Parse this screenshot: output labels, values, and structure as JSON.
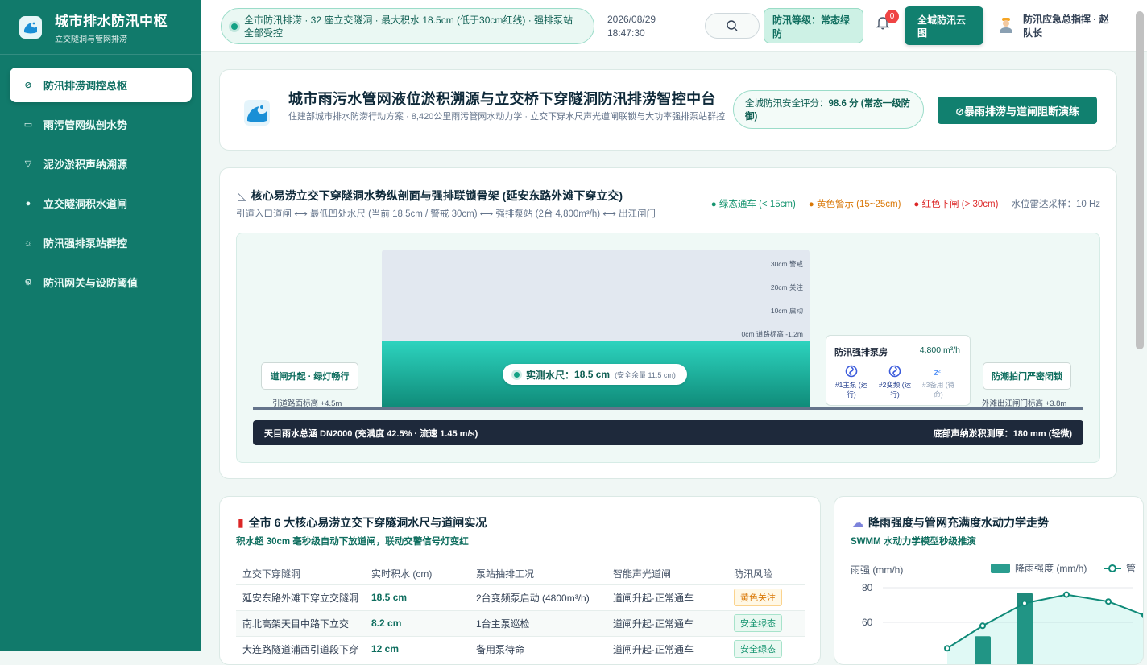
{
  "app": {
    "title": "城市排水防汛中枢",
    "subtitle": "立交隧洞与管网排涝"
  },
  "sidebar": {
    "items": [
      {
        "label": "防汛排涝调控总枢",
        "icon": "compass-icon",
        "active": true
      },
      {
        "label": "雨污管网纵剖水势",
        "icon": "monitor-icon",
        "active": false
      },
      {
        "label": "泥沙淤积声纳溯源",
        "icon": "filter-icon",
        "active": false
      },
      {
        "label": "立交隧洞积水道闸",
        "icon": "alert-icon",
        "active": false
      },
      {
        "label": "防汛强排泵站群控",
        "icon": "sun-icon",
        "active": false
      },
      {
        "label": "防汛网关与设防阈值",
        "icon": "gear-icon",
        "active": false
      }
    ]
  },
  "topbar": {
    "ticker": "全市防汛排涝 · 32 座立交隧洞 · 最大积水 18.5cm (低于30cm红线) · 强排泵站全部受控",
    "date": "2026/08/29",
    "time": "18:47:30",
    "level": "防汛等级：常态绿防",
    "notifications": "0",
    "cloud_button": "全城防汛云图",
    "user": "防汛应急总指挥 · 赵队长"
  },
  "hero": {
    "title": "城市雨污水管网液位淤积溯源与立交桥下穿隧洞防汛排涝智控中台",
    "subtitle": "住建部城市排水防涝行动方案 · 8,420公里雨污管网水动力学 · 立交下穿水尺声光道闸联锁与大功率强排泵站群控",
    "score_label": "全城防汛安全评分：",
    "score_value": "98.6 分 (常态一级防御)",
    "drill_button": "⊘暴雨排涝与道闸阻断演练"
  },
  "profile": {
    "title": "核心易涝立交下穿隧洞水势纵剖面与强排联锁骨架 (延安东路外滩下穿立交)",
    "subtitle": "引道入口道闸 ⟷ 最低凹处水尺 (当前 18.5cm / 警戒 30cm) ⟷ 强排泵站 (2台 4,800m³/h) ⟷ 出江闸门",
    "legend": [
      {
        "label": "● 绿态通车 (< 15cm)",
        "color": "#15946f"
      },
      {
        "label": "● 黄色警示 (15~25cm)",
        "color": "#d97706"
      },
      {
        "label": "● 红色下闸 (> 30cm)",
        "color": "#dc2626"
      },
      {
        "label": "水位雷达采样：10 Hz",
        "color": "#64748b"
      }
    ],
    "scale": [
      "30cm 警戒",
      "20cm 关注",
      "10cm 启动",
      "0cm 道路标高 -1.2m"
    ],
    "gauge_label": "实测水尺：",
    "gauge_value": "18.5 cm",
    "gauge_note": "(安全余量 11.5 cm)",
    "water_level_cm": 18.5,
    "left_gate": "道闸升起 · 绿灯畅行",
    "left_elev": "引道路面标高 +4.5m",
    "right_gate": "防潮拍门严密闭锁",
    "right_elev": "外滩出江闸门标高 +3.8m",
    "pumphouse_title": "防汛强排泵房",
    "pumphouse_flow": "4,800 m³/h",
    "pumps": [
      {
        "label": "#1主泵 (运行)",
        "icon": "fan-icon"
      },
      {
        "label": "#2变频 (运行)",
        "icon": "fan-icon"
      },
      {
        "label": "#3备用 (待命)",
        "icon": "sleep-icon"
      }
    ],
    "pipe_left": "天目雨水总涵 DN2000 (充满度 42.5% · 流速 1.45 m/s)",
    "pipe_right": "底部声纳淤积测厚：180 mm (轻微)"
  },
  "tunnels": {
    "title": "全市 6 大核心易涝立交下穿隧洞水尺与道闸实况",
    "subtitle": "积水超 30cm 毫秒级自动下放道闸，联动交警信号灯变红",
    "headers": [
      "立交下穿隧洞",
      "实时积水 (cm)",
      "泵站抽排工况",
      "智能声光道闸",
      "防汛风险"
    ],
    "rows": [
      {
        "name": "延安东路外滩下穿立交隧洞",
        "depth": "18.5 cm",
        "pump": "2台变频泵启动 (4800m³/h)",
        "gate": "道闸升起·正常通车",
        "risk": "黄色关注",
        "risk_level": "yellow"
      },
      {
        "name": "南北高架天目中路下立交",
        "depth": "8.2 cm",
        "pump": "1台主泵巡检",
        "gate": "道闸升起·正常通车",
        "risk": "安全绿态",
        "risk_level": "green"
      },
      {
        "name": "大连路隧道浦西引道段下穿",
        "depth": "12 cm",
        "pump": "备用泵待命",
        "gate": "道闸升起·正常通车",
        "risk": "安全绿态",
        "risk_level": "green"
      }
    ]
  },
  "rain": {
    "title": "降雨强度与管网充满度水动力学走势",
    "subtitle": "SWMM 水动力学模型秒级推演",
    "chart_data": {
      "type": "bar",
      "ylabel": "雨强 (mm/h)",
      "yticks": [
        "80",
        "60"
      ],
      "ylim": [
        40,
        80
      ],
      "series": [
        {
          "name": "降雨强度 (mm/h)",
          "type": "bar",
          "values": [
            52,
            77
          ]
        },
        {
          "name": "管",
          "type": "line",
          "values": [
            45,
            58,
            71,
            76,
            72,
            64
          ]
        }
      ]
    }
  },
  "colors": {
    "brand": "#117a6b",
    "accent": "#11806f",
    "water": "#2dd4bf",
    "warning": "#d97706",
    "danger": "#dc2626"
  }
}
